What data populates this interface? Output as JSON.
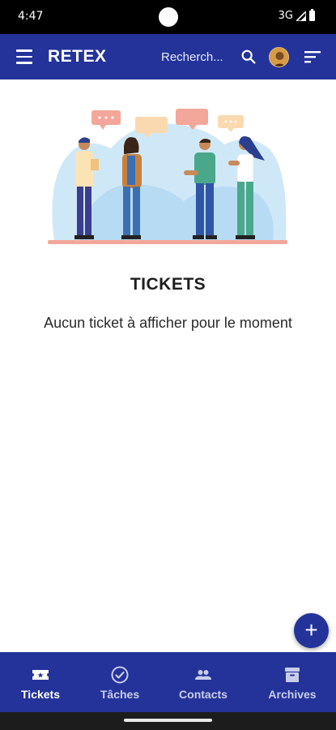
{
  "status_bar": {
    "time": "4:47",
    "network": "3G"
  },
  "app_bar": {
    "title": "RETEX",
    "search_placeholder": "Recherch..."
  },
  "main": {
    "title": "TICKETS",
    "empty_message": "Aucun ticket à afficher pour le moment"
  },
  "fab": {
    "icon": "plus-icon",
    "label": "+"
  },
  "bottom_nav": {
    "items": [
      {
        "label": "Tickets",
        "icon": "ticket-icon",
        "active": true
      },
      {
        "label": "Tâches",
        "icon": "check-circle-icon",
        "active": false
      },
      {
        "label": "Contacts",
        "icon": "people-icon",
        "active": false
      },
      {
        "label": "Archives",
        "icon": "archive-icon",
        "active": false
      }
    ]
  },
  "colors": {
    "primary": "#23339a",
    "background": "#ffffff",
    "illustration_bg": "#cfe8f7",
    "status_bar": "#000000"
  }
}
